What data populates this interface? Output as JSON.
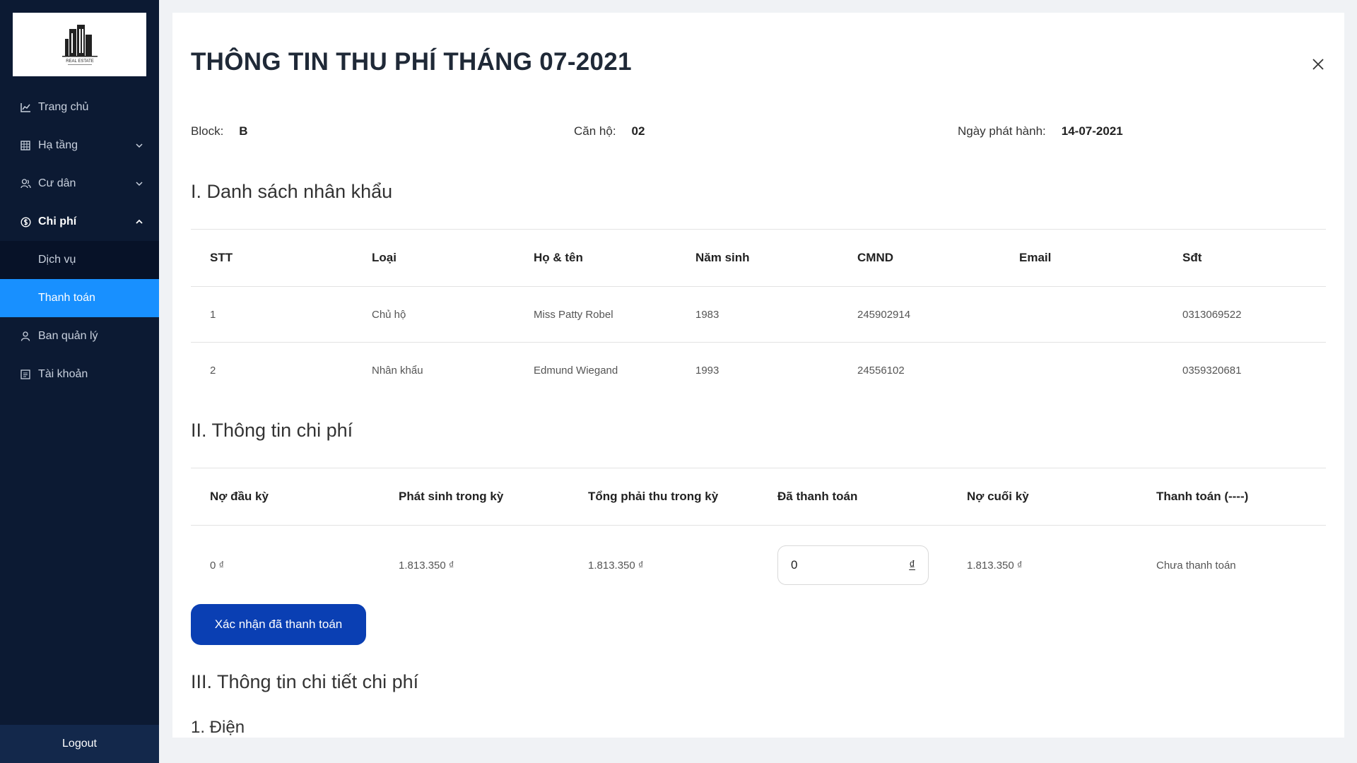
{
  "sidebar": {
    "logo_text": "REAL ESTATE",
    "items": [
      {
        "label": "Trang chủ",
        "icon": "chart-icon"
      },
      {
        "label": "Hạ tầng",
        "icon": "building-icon"
      },
      {
        "label": "Cư dân",
        "icon": "users-icon"
      },
      {
        "label": "Chi phí",
        "icon": "money-icon"
      },
      {
        "label": "Dịch vụ"
      },
      {
        "label": "Thanh toán"
      },
      {
        "label": "Ban quản lý",
        "icon": "user-icon"
      },
      {
        "label": "Tài khoản",
        "icon": "account-icon"
      }
    ],
    "logout": "Logout",
    "active_color": "#1890ff",
    "bg_color": "#0c1a33"
  },
  "modal": {
    "title": "THÔNG TIN THU PHÍ THÁNG 07-2021",
    "block_label": "Block:",
    "block_value": "B",
    "apartment_label": "Căn hộ:",
    "apartment_value": "02",
    "issue_date_label": "Ngày phát hành:",
    "issue_date_value": "14-07-2021",
    "section1": "I. Danh sách nhân khẩu",
    "residents_headers": [
      "STT",
      "Loại",
      "Họ & tên",
      "Năm sinh",
      "CMND",
      "Email",
      "Sđt"
    ],
    "residents": [
      [
        "1",
        "Chủ hộ",
        "Miss Patty Robel",
        "1983",
        "245902914",
        "",
        "0313069522"
      ],
      [
        "2",
        "Nhân khẩu",
        "Edmund Wiegand",
        "1993",
        "24556102",
        "",
        "0359320681"
      ]
    ],
    "section2": "II. Thông tin chi phí",
    "fee_headers": [
      "Nợ đầu kỳ",
      "Phát sinh trong kỳ",
      "Tổng phải thu trong kỳ",
      "Đã thanh toán",
      "Nợ cuối kỳ",
      "Thanh toán (----)"
    ],
    "fee_row": {
      "opening_debt": "0 ₫",
      "incurred": "1.813.350 ₫",
      "total_due": "1.813.350 ₫",
      "paid_input_value": "0",
      "currency_symbol": "₫",
      "closing_debt": "1.813.350 ₫",
      "payment_status": "Chưa thanh toán"
    },
    "confirm_button": "Xác nhận đã thanh toán",
    "confirm_color": "#0a3fb3",
    "section3": "III. Thông tin chi tiết chi phí",
    "subsection1": "1. Điện"
  }
}
